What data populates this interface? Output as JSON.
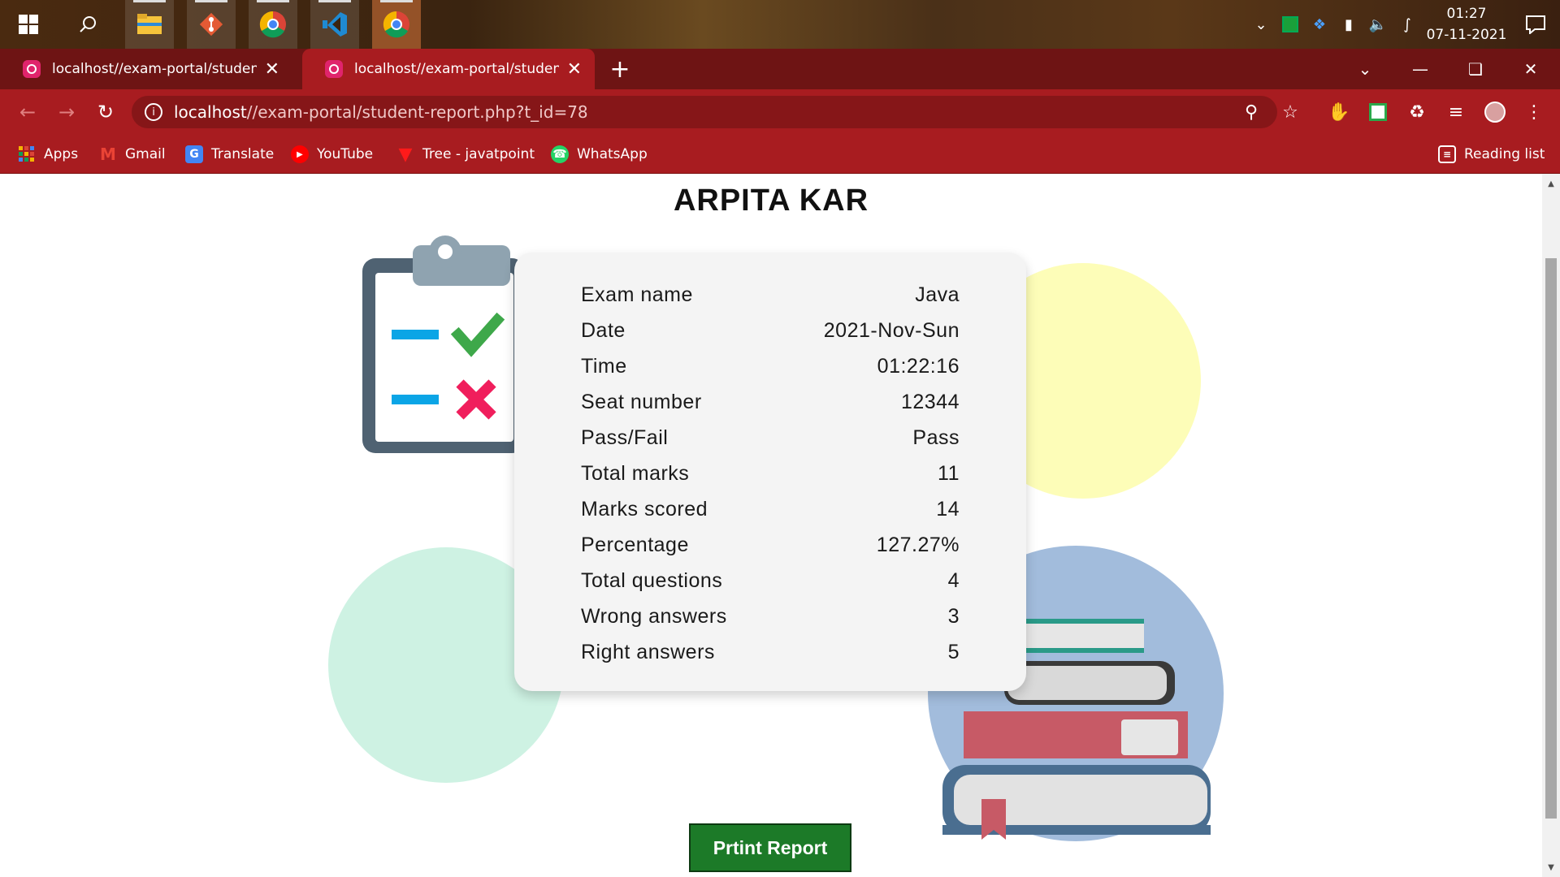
{
  "taskbar": {
    "start_icon": "windows-icon",
    "search_icon": "search-icon",
    "apps": [
      "file-explorer-icon",
      "git-icon",
      "chrome-profile-icon",
      "vscode-icon",
      "chrome-active-icon"
    ],
    "time": "01:27",
    "date": "07-11-2021"
  },
  "browser": {
    "tabs": [
      {
        "title": "localhost//exam-portal/student-r"
      },
      {
        "title": "localhost//exam-portal/student-r"
      }
    ],
    "url_host": "localhost",
    "url_path": "//exam-portal/student-report.php?t_id=78",
    "bookmarks": [
      {
        "label": "Apps"
      },
      {
        "label": "Gmail"
      },
      {
        "label": "Translate"
      },
      {
        "label": "YouTube"
      },
      {
        "label": "Tree - javatpoint"
      },
      {
        "label": "WhatsApp"
      }
    ],
    "reading_list": "Reading list"
  },
  "report": {
    "student_name": "ARPITA KAR",
    "rows": [
      {
        "label": "Exam name",
        "value": "Java"
      },
      {
        "label": "Date",
        "value": "2021-Nov-Sun"
      },
      {
        "label": "Time",
        "value": "01:22:16"
      },
      {
        "label": "Seat number",
        "value": "12344"
      },
      {
        "label": "Pass/Fail",
        "value": "Pass"
      },
      {
        "label": "Total marks",
        "value": "11"
      },
      {
        "label": "Marks scored",
        "value": "14"
      },
      {
        "label": "Percentage",
        "value": "127.27%"
      },
      {
        "label": "Total questions",
        "value": "4"
      },
      {
        "label": "Wrong answers",
        "value": "3"
      },
      {
        "label": "Right answers",
        "value": "5"
      }
    ],
    "print_button": "Prtint Report"
  },
  "colors": {
    "browser_red": "#a81c20",
    "button_green": "#1c7a28",
    "yellow_circle": "#fdfdb8",
    "mint_circle": "#cef2e3",
    "blue_circle": "#a2bcdc"
  }
}
